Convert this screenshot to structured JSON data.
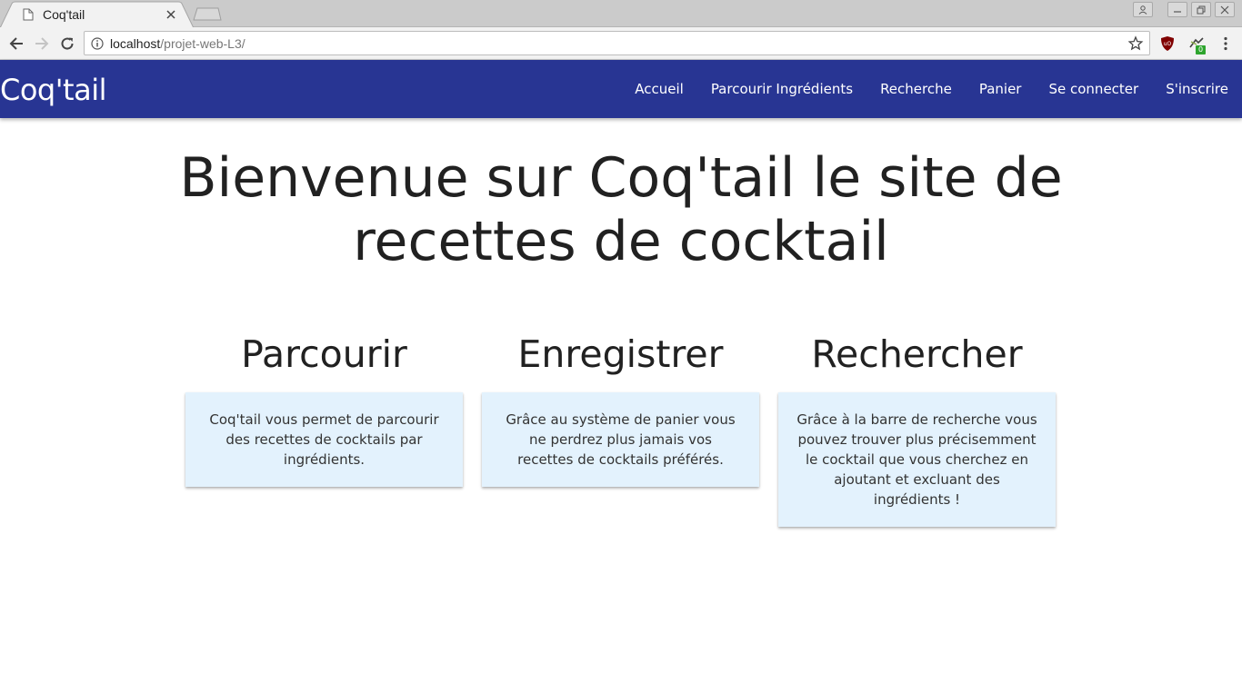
{
  "browser": {
    "tab_title": "Coq'tail",
    "url_host": "localhost",
    "url_path": "/projet-web-L3/",
    "extension_badge": "0"
  },
  "site": {
    "brand": "Coq'tail",
    "nav": {
      "home": "Accueil",
      "browse_ingredients": "Parcourir Ingrédients",
      "search": "Recherche",
      "cart": "Panier",
      "login": "Se connecter",
      "signup": "S'inscrire"
    },
    "hero_title": "Bienvenue sur Coq'tail le site de recettes de cocktail",
    "features": [
      {
        "title": "Parcourir",
        "text": "Coq'tail vous permet de parcourir des recettes de cocktails par ingrédients."
      },
      {
        "title": "Enregistrer",
        "text": "Grâce au système de panier vous ne perdrez plus jamais vos recettes de cocktails préférés."
      },
      {
        "title": "Rechercher",
        "text": "Grâce à la barre de recherche vous pouvez trouver plus précisemment le cocktail que vous cherchez en ajoutant et excluant des ingrédients !"
      }
    ],
    "colors": {
      "navbar": "#283593",
      "card": "#e3f2fd"
    }
  },
  "icons": {
    "tab_favicon": "page-icon",
    "back": "arrow-left-icon",
    "forward": "arrow-right-icon",
    "reload": "reload-icon",
    "info": "info-icon",
    "bookmark": "star-icon",
    "ublock": "ublock-shield-icon",
    "extension": "extension-icon",
    "menu": "kebab-menu-icon"
  }
}
